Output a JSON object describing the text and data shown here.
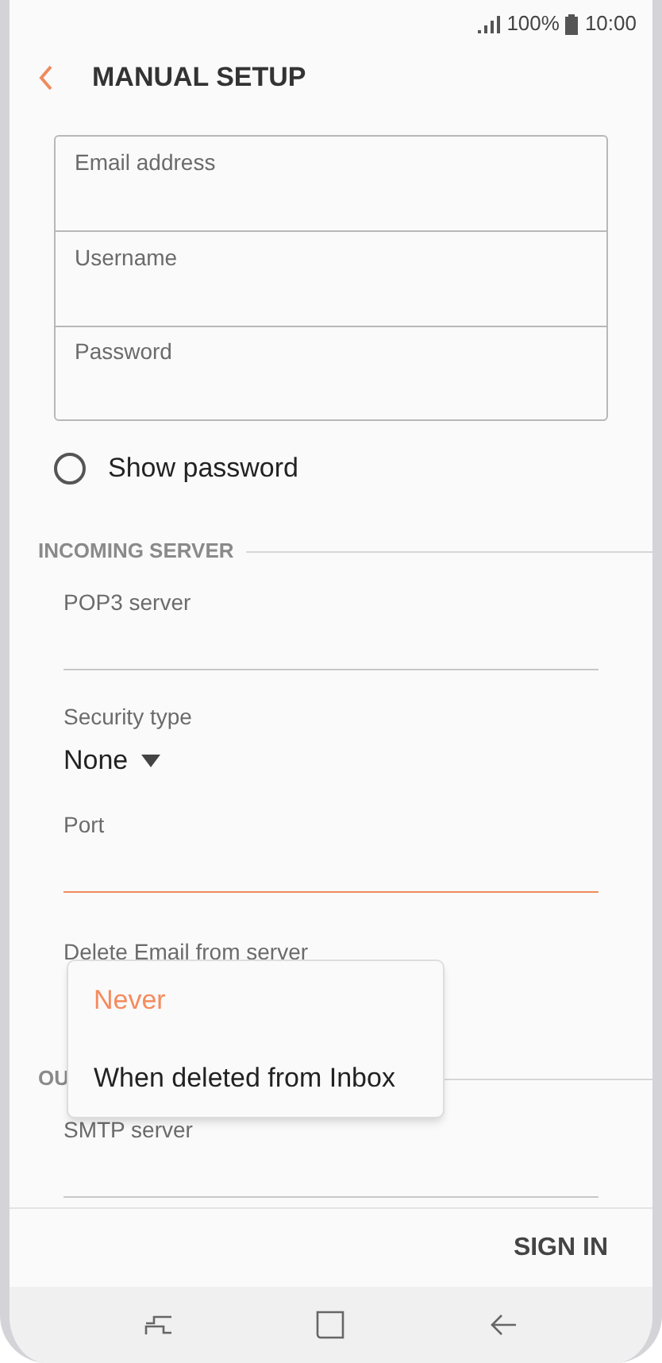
{
  "status_bar": {
    "battery": "100%",
    "time": "10:00"
  },
  "header": {
    "title": "MANUAL SETUP"
  },
  "account_fields": [
    {
      "placeholder": "Email address"
    },
    {
      "placeholder": "Username"
    },
    {
      "placeholder": "Password"
    }
  ],
  "show_password": {
    "label": "Show password",
    "checked": false
  },
  "incoming_server": {
    "heading": "INCOMING SERVER",
    "fields": [
      {
        "kind": "text",
        "label": "POP3 server",
        "focused": false
      },
      {
        "kind": "dropdown",
        "label": "Security type",
        "value": "None"
      },
      {
        "kind": "text",
        "label": "Port",
        "focused": true
      },
      {
        "kind": "label",
        "label": "Delete Email from server"
      }
    ]
  },
  "delete_menu": {
    "options": [
      {
        "label": "Never",
        "selected": true
      },
      {
        "label": "When deleted from Inbox",
        "selected": false
      }
    ]
  },
  "outgoing_server": {
    "heading": "OU",
    "fields": [
      {
        "kind": "text",
        "label": "SMTP server",
        "focused": false
      }
    ]
  },
  "footer": {
    "action": "SIGN IN"
  }
}
